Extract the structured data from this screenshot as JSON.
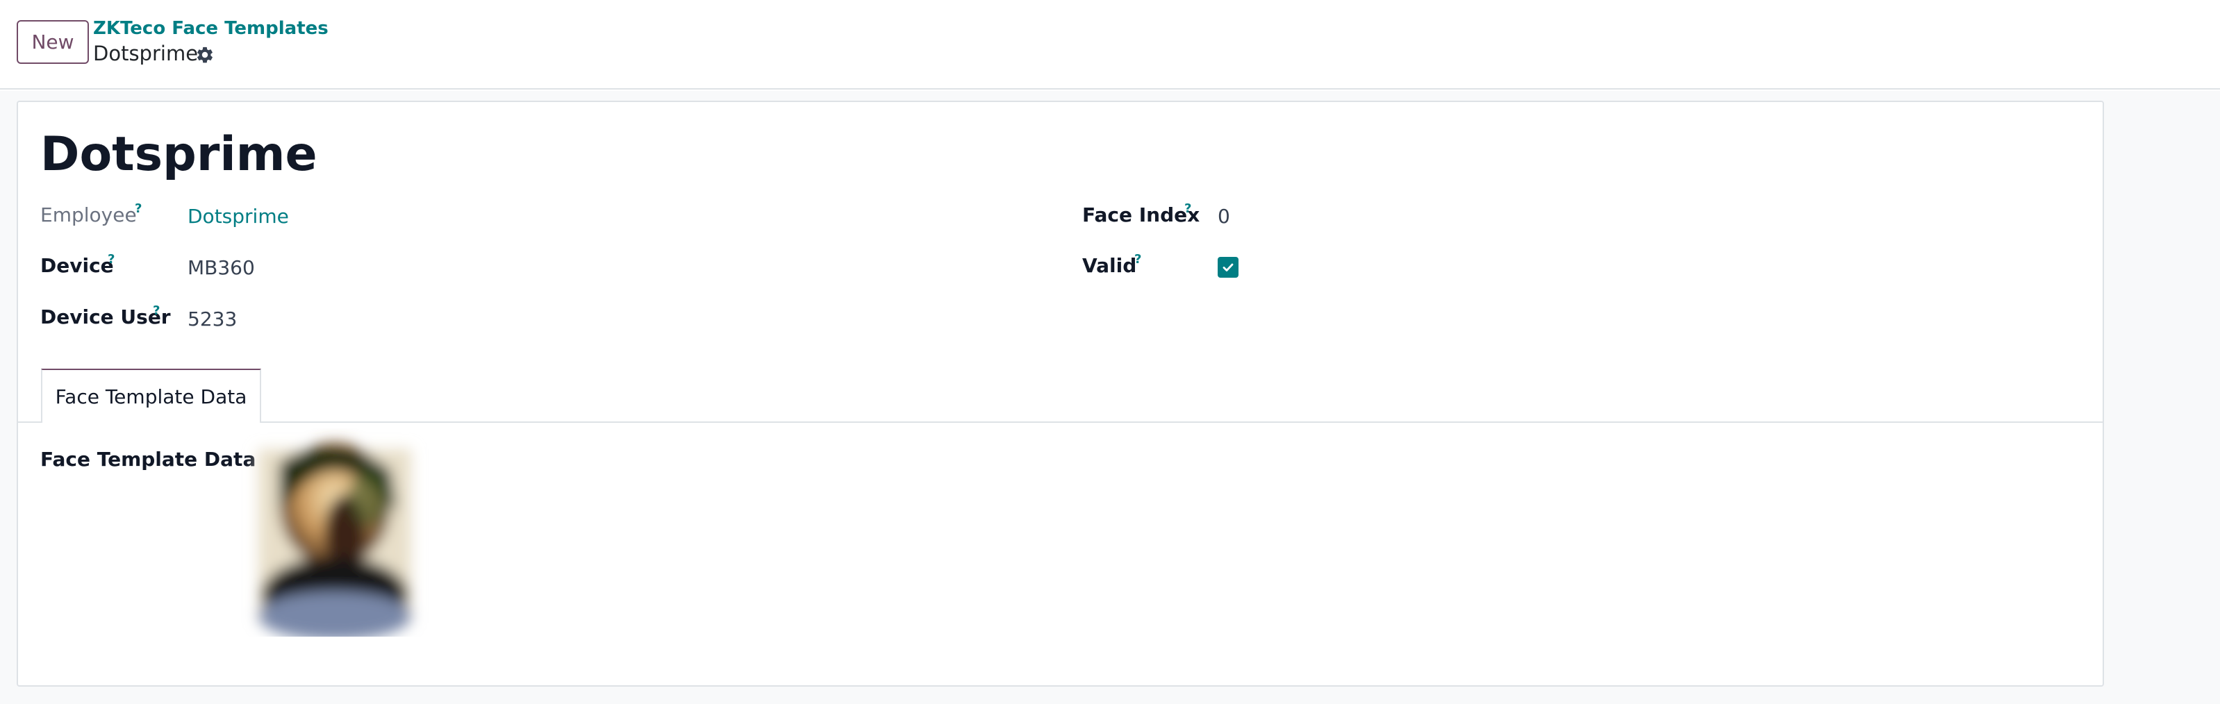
{
  "control_panel": {
    "new_button": "New",
    "breadcrumb": "ZKTeco Face Templates",
    "record_title": "Dotsprime",
    "gear_icon": "gear-icon"
  },
  "record": {
    "name": "Dotsprime",
    "help_mark": "?",
    "fields_left": [
      {
        "label": "Employee",
        "value": "Dotsprime",
        "style": "link"
      },
      {
        "label": "Device",
        "value": "MB360"
      },
      {
        "label": "Device User",
        "value": "5233"
      }
    ],
    "fields_right": [
      {
        "label": "Face Index",
        "value": "0"
      },
      {
        "label": "Valid",
        "checked": true
      }
    ]
  },
  "notebook": {
    "tabs": [
      {
        "label": "Face Template Data",
        "active": true
      }
    ],
    "image_field_label": "Face Template Data",
    "image_icon": "face-template-image"
  },
  "colors": {
    "brand": "#714b67",
    "link": "#017e84",
    "border": "#dee2e6"
  }
}
